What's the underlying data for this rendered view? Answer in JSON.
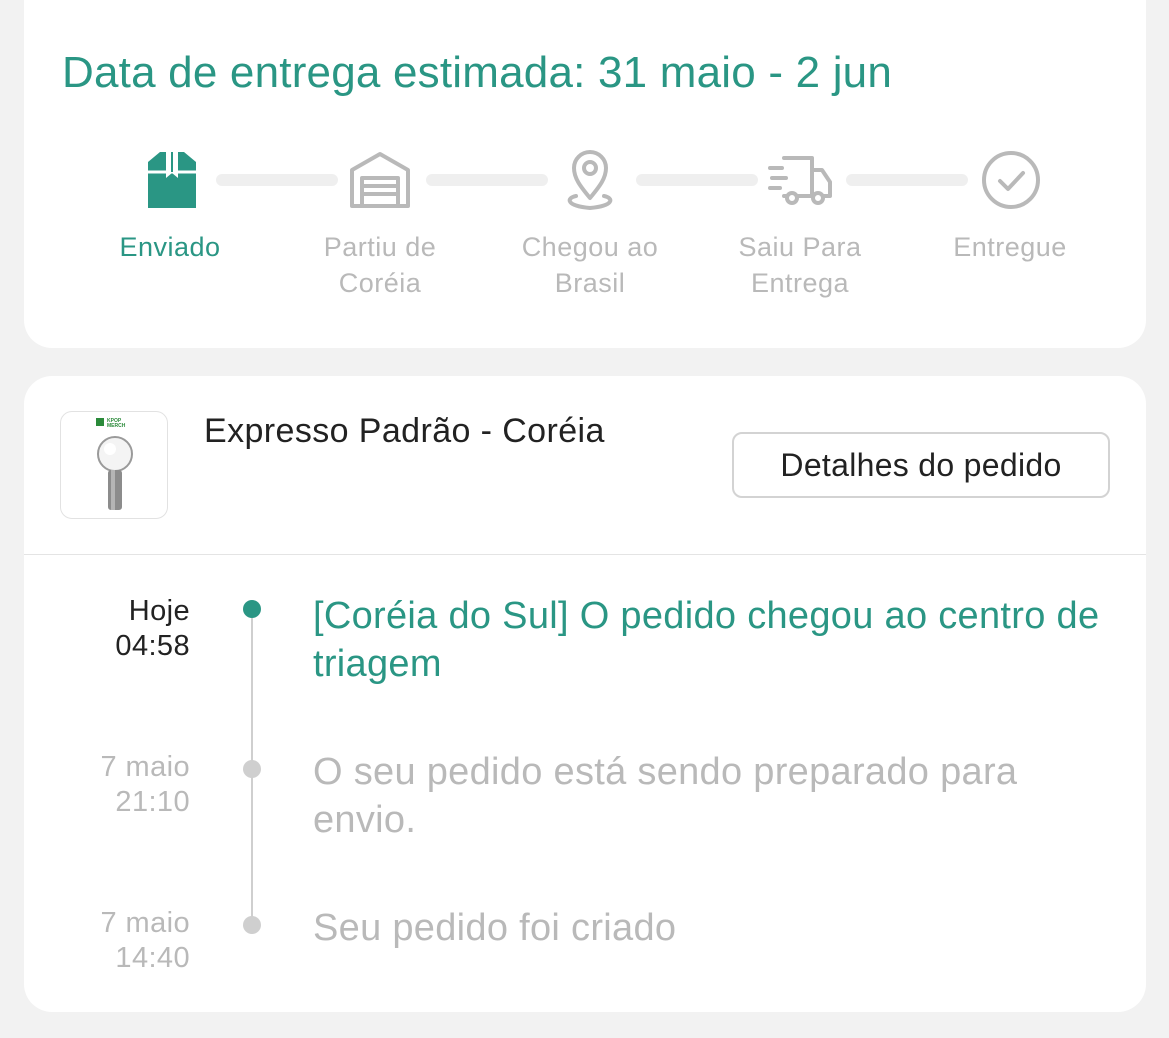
{
  "header": {
    "eta_title": "Data de entrega estimada: 31 maio - 2 jun"
  },
  "progress": {
    "active_index": 0,
    "steps": [
      {
        "label": "Enviado",
        "icon": "package-icon",
        "active": true
      },
      {
        "label": "Partiu de\nCoréia",
        "icon": "warehouse-icon",
        "active": false
      },
      {
        "label": "Chegou ao\nBrasil",
        "icon": "location-pin-icon",
        "active": false
      },
      {
        "label": "Saiu Para\nEntrega",
        "icon": "delivery-truck-icon",
        "active": false
      },
      {
        "label": "Entregue",
        "icon": "check-circle-icon",
        "active": false
      }
    ]
  },
  "shipment": {
    "product_logo_text": "KPOP MERCH",
    "method": "Expresso Padrão - Coréia",
    "details_button": "Detalhes do pedido"
  },
  "timeline": [
    {
      "date": "Hoje",
      "time": "04:58",
      "text": "[Coréia do Sul] O pedido chegou ao centro de triagem",
      "active": true
    },
    {
      "date": "7 maio",
      "time": "21:10",
      "text": "O seu pedido está sendo preparado para envio.",
      "active": false
    },
    {
      "date": "7 maio",
      "time": "14:40",
      "text": "Seu pedido foi criado",
      "active": false
    }
  ],
  "colors": {
    "accent": "#2a9684",
    "inactive": "#b9b9b9",
    "background": "#f2f2f2",
    "card": "#ffffff"
  }
}
